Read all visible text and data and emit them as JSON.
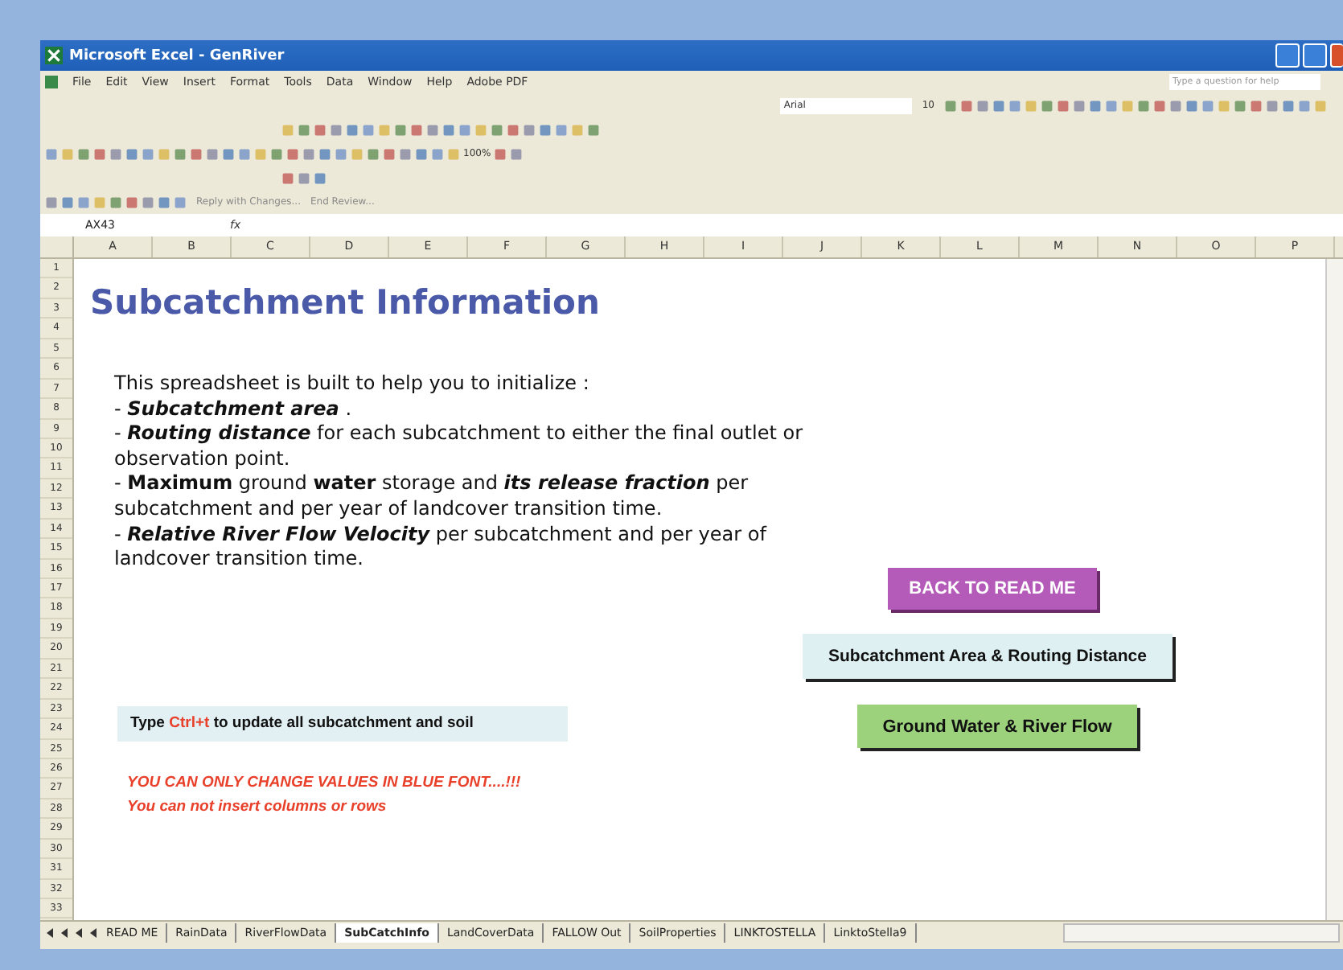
{
  "window": {
    "title": "Microsoft Excel - GenRiver"
  },
  "menu": [
    "File",
    "Edit",
    "View",
    "Insert",
    "Format",
    "Tools",
    "Data",
    "Window",
    "Help",
    "Adobe PDF"
  ],
  "help_box": {
    "placeholder": "Type a question for help"
  },
  "formatting": {
    "font": "Arial",
    "size": "10"
  },
  "standard": {
    "zoom": "100%"
  },
  "reviewing": {
    "reply": "Reply with Changes...",
    "end_review": "End Review..."
  },
  "formula_bar": {
    "name_box": "AX43",
    "fx": "fx"
  },
  "columns": [
    "A",
    "B",
    "C",
    "D",
    "E",
    "F",
    "G",
    "H",
    "I",
    "J",
    "K",
    "L",
    "M",
    "N",
    "O",
    "P"
  ],
  "rows": [
    "1",
    "2",
    "3",
    "4",
    "5",
    "6",
    "7",
    "8",
    "9",
    "10",
    "11",
    "12",
    "13",
    "14",
    "15",
    "16",
    "17",
    "18",
    "19",
    "20",
    "21",
    "22",
    "23",
    "24",
    "25",
    "26",
    "27",
    "28",
    "29",
    "30",
    "31",
    "32",
    "33"
  ],
  "sheet": {
    "title": "Subcatchment Information",
    "intro": [
      "This spreadsheet is built to help you to initialize :",
      "- *Subcatchment area* .",
      "- *Routing distance* for each subcatchment to either the final outlet or observation point.",
      "- **Maximum** ground **water** storage and *its release fraction* per subcatchment and per year of landcover transition time.",
      "- *Relative River Flow Velocity* per subcatchment and per year of landcover transition time."
    ],
    "buttons": [
      {
        "label": "BACK TO READ ME",
        "kind": "purple"
      },
      {
        "label": "Subcatchment Area & Routing Distance",
        "kind": "cyan"
      },
      {
        "label": "Ground Water & River Flow",
        "kind": "green"
      }
    ],
    "note": {
      "prefix": "Type ",
      "shortcut": "Ctrl+t",
      "suffix": " to update all subcatchment and soil"
    },
    "warnings": [
      "YOU CAN ONLY CHANGE VALUES IN BLUE FONT....!!!",
      "You can not insert columns or rows"
    ]
  },
  "sheet_tabs": [
    {
      "label": "READ ME",
      "selected": false
    },
    {
      "label": "RainData",
      "selected": false
    },
    {
      "label": "RiverFlowData",
      "selected": false
    },
    {
      "label": "SubCatchInfo",
      "selected": true
    },
    {
      "label": "LandCoverData",
      "selected": false
    },
    {
      "label": "FALLOW Out",
      "selected": false
    },
    {
      "label": "SoilProperties",
      "selected": false
    },
    {
      "label": "LINKTOSTELLA",
      "selected": false
    },
    {
      "label": "LinktoStella9",
      "selected": false
    }
  ]
}
